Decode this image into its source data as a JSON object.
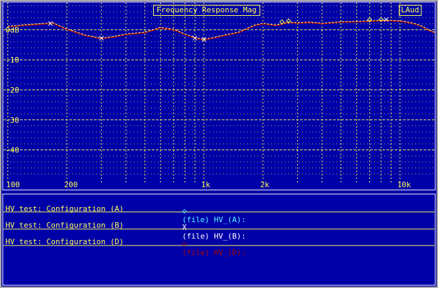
{
  "app": {
    "mode_button": "LAud"
  },
  "chart_data": {
    "type": "line",
    "title": "Frequency Response Mag",
    "xscale": "log",
    "xlim": [
      95,
      15000
    ],
    "ylim": [
      -49,
      9
    ],
    "y_ticks": [
      0,
      -10,
      -20,
      -30,
      -40
    ],
    "y_tick_labels": [
      "0dB",
      "-10",
      "-20",
      "-30",
      "-40"
    ],
    "x_ticks": [
      100,
      200,
      1000,
      2000,
      10000
    ],
    "x_tick_labels": [
      "100",
      "200",
      "1k",
      "2k",
      "10k"
    ],
    "grid": true,
    "series": [
      {
        "name": "HV_(A)",
        "color": "#ffff55",
        "x": [
          100,
          130,
          170,
          200,
          250,
          300,
          350,
          400,
          500,
          600,
          700,
          800,
          900,
          1000,
          1100,
          1300,
          1500,
          1800,
          2000,
          2300,
          2500,
          2700,
          3000,
          3500,
          4000,
          5000,
          6000,
          7000,
          8000,
          9000,
          10000,
          11000,
          12000,
          13000,
          14000,
          15000
        ],
        "y": [
          1.2,
          1.8,
          2.3,
          0.3,
          -1.8,
          -2.8,
          -2.2,
          -1.4,
          -0.8,
          0.8,
          0.2,
          -1.4,
          -2.6,
          -3.2,
          -2.7,
          -1.6,
          -0.8,
          1.5,
          2.2,
          1.6,
          2.0,
          2.6,
          2.4,
          2.6,
          2.2,
          2.7,
          2.8,
          3.0,
          3.2,
          3.2,
          3.0,
          2.6,
          2.0,
          1.2,
          0.0,
          -0.8
        ],
        "markers": [
          [
            2500,
            2.6
          ],
          [
            2700,
            2.9
          ],
          [
            7000,
            3.3
          ],
          [
            8000,
            3.4
          ]
        ]
      },
      {
        "name": "HV_(B)",
        "color": "#ffffff",
        "x": [
          100,
          130,
          170,
          200,
          250,
          300,
          350,
          400,
          500,
          600,
          700,
          800,
          900,
          1000,
          1100,
          1300,
          1500,
          1800,
          2000,
          2300,
          2500,
          2700,
          3000,
          3500,
          4000,
          5000,
          6000,
          7000,
          8000,
          9000,
          10000,
          11000,
          12000,
          13000,
          14000,
          15000
        ],
        "y": [
          1.2,
          1.8,
          2.3,
          0.3,
          -1.8,
          -2.8,
          -2.2,
          -1.4,
          -0.8,
          0.8,
          0.2,
          -1.4,
          -2.6,
          -3.2,
          -2.7,
          -1.6,
          -0.8,
          1.5,
          2.2,
          1.6,
          2.0,
          2.6,
          2.4,
          2.6,
          2.2,
          2.7,
          2.8,
          3.0,
          3.2,
          3.2,
          3.0,
          2.6,
          2.0,
          1.2,
          0.0,
          -0.8
        ],
        "markers": [
          [
            165,
            2.1
          ],
          [
            300,
            -2.8
          ],
          [
            900,
            -2.8
          ],
          [
            1000,
            -3.2
          ],
          [
            8500,
            3.4
          ]
        ]
      },
      {
        "name": "HV_(D)",
        "color": "#aa0000",
        "x": [
          100,
          130,
          170,
          200,
          250,
          300,
          350,
          400,
          500,
          600,
          700,
          800,
          900,
          1000,
          1100,
          1300,
          1500,
          1800,
          2000,
          2300,
          2500,
          2700,
          3000,
          3500,
          4000,
          5000,
          6000,
          7000,
          8000,
          9000,
          10000,
          11000,
          12000,
          13000,
          14000,
          15000
        ],
        "y": [
          1.0,
          1.6,
          2.1,
          0.1,
          -2.0,
          -3.0,
          -2.4,
          -1.6,
          -1.0,
          0.6,
          0.0,
          -1.6,
          -2.8,
          -3.4,
          -2.9,
          -1.8,
          -1.0,
          1.3,
          2.0,
          1.4,
          1.8,
          2.4,
          2.2,
          2.4,
          2.0,
          2.5,
          2.6,
          2.8,
          3.0,
          3.0,
          2.8,
          2.4,
          1.8,
          1.0,
          -0.2,
          -1.0
        ],
        "markers": []
      }
    ]
  },
  "legend": {
    "items": [
      {
        "marker": "◇",
        "text": "(file) HV_(A):",
        "label": "HV test: Configuration (A)",
        "color": "#55ffff"
      },
      {
        "marker": "X",
        "text": "(file) HV_(B):",
        "label": "HV test: Configuration (B)",
        "color": "#ffffff"
      },
      {
        "marker": "○",
        "text": "(file) HV_(D):",
        "label": "HV test: Configuration (D)",
        "color": "#aa0000"
      }
    ]
  }
}
